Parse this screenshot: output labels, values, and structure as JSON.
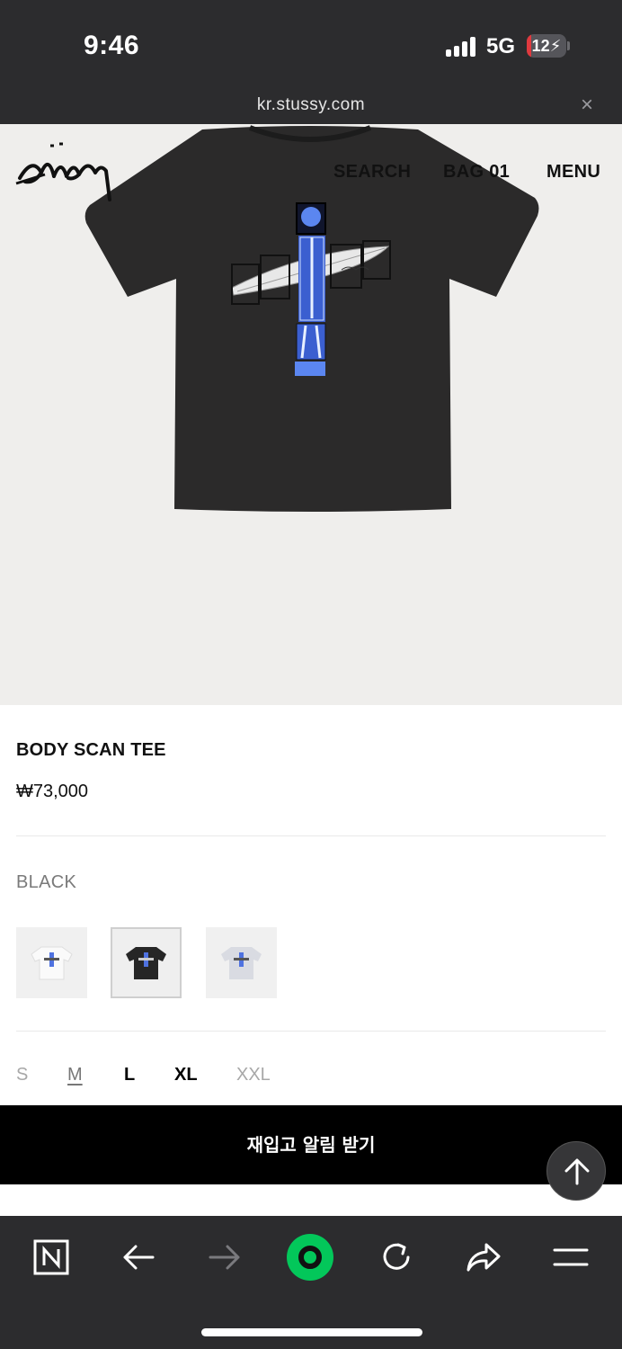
{
  "status_bar": {
    "time": "9:46",
    "network": "5G",
    "battery": "12",
    "battery_level": 0.12
  },
  "browser": {
    "url": "kr.stussy.com",
    "close_label": "×"
  },
  "site_header": {
    "logo_alt": "Stüssy",
    "search": "SEARCH",
    "bag": "BAG 01",
    "menu": "MENU"
  },
  "product": {
    "title": "BODY SCAN TEE",
    "price": "₩73,000",
    "color": "BLACK",
    "swatches": [
      {
        "color": "white",
        "selected": false
      },
      {
        "color": "black",
        "selected": true
      },
      {
        "color": "grey",
        "selected": false
      }
    ],
    "sizes": [
      {
        "label": "S",
        "state": "unavailable"
      },
      {
        "label": "M",
        "state": "current"
      },
      {
        "label": "L",
        "state": "available"
      },
      {
        "label": "XL",
        "state": "available"
      },
      {
        "label": "XXL",
        "state": "unavailable"
      }
    ],
    "restock_button": "재입고 알림 받기"
  },
  "toolbar": {
    "icons": [
      "naver-home-icon",
      "back-arrow-icon",
      "forward-arrow-icon",
      "green-circle-icon",
      "reload-icon",
      "share-icon",
      "menu-icon"
    ]
  },
  "colors": {
    "accent_green": "#03c75a",
    "dark_bg": "#2c2c2e",
    "hero_bg": "#efeeec",
    "xray_blue": "#4f72e0"
  }
}
